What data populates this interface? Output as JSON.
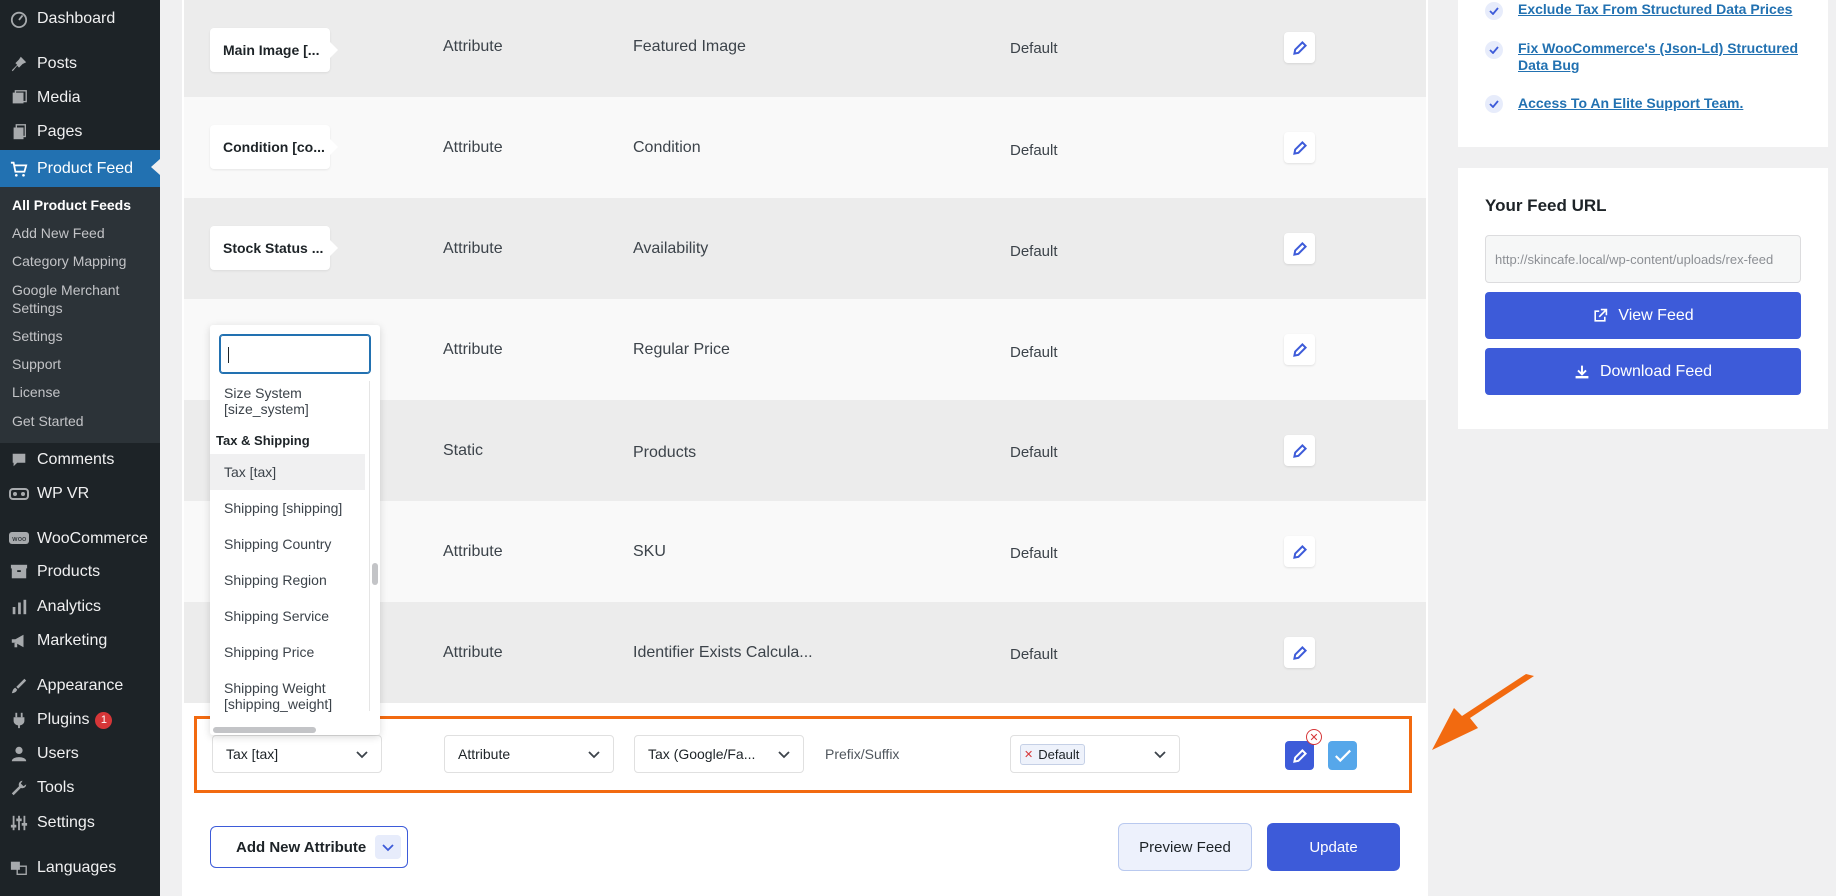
{
  "sidebar": {
    "items": [
      {
        "label": "Dashboard",
        "icon": "dashboard-icon"
      },
      {
        "label": "Posts",
        "icon": "pin-icon"
      },
      {
        "label": "Media",
        "icon": "media-icon"
      },
      {
        "label": "Pages",
        "icon": "pages-icon"
      },
      {
        "label": "Product Feed",
        "icon": "cart-icon"
      },
      {
        "label": "Comments",
        "icon": "comment-icon"
      },
      {
        "label": "WP VR",
        "icon": "vr-icon"
      },
      {
        "label": "WooCommerce",
        "icon": "woo-icon"
      },
      {
        "label": "Products",
        "icon": "box-icon"
      },
      {
        "label": "Analytics",
        "icon": "bar-chart-icon"
      },
      {
        "label": "Marketing",
        "icon": "megaphone-icon"
      },
      {
        "label": "Appearance",
        "icon": "brush-icon"
      },
      {
        "label": "Plugins",
        "icon": "plugin-icon",
        "badge": "1"
      },
      {
        "label": "Users",
        "icon": "user-icon"
      },
      {
        "label": "Tools",
        "icon": "wrench-icon"
      },
      {
        "label": "Settings",
        "icon": "settings-icon"
      },
      {
        "label": "Languages",
        "icon": "languages-icon"
      }
    ],
    "submenu": [
      "All Product Feeds",
      "Add New Feed",
      "Category Mapping",
      "Google Merchant Settings",
      "Settings",
      "Support",
      "License",
      "Get Started"
    ]
  },
  "rows": [
    {
      "name": "Main Image [...",
      "type": "Attribute",
      "value": "Featured Image",
      "prefix": "Default"
    },
    {
      "name": "Condition [co...",
      "type": "Attribute",
      "value": "Condition",
      "prefix": "Default"
    },
    {
      "name": "Stock Status ...",
      "type": "Attribute",
      "value": "Availability",
      "prefix": "Default"
    },
    {
      "name": "",
      "type": "Attribute",
      "value": "Regular Price",
      "prefix": "Default"
    },
    {
      "name": "",
      "type": "Static",
      "value": "Products",
      "prefix": "Default"
    },
    {
      "name": "",
      "type": "Attribute",
      "value": "SKU",
      "prefix": "Default"
    },
    {
      "name": "",
      "type": "Attribute",
      "value": "Identifier Exists Calcula...",
      "prefix": "Default"
    }
  ],
  "dropdown": {
    "search_value": "",
    "items_top": [
      "Size System",
      "[size_system]"
    ],
    "group_label": "Tax & Shipping",
    "items": [
      "Tax [tax]",
      "Shipping [shipping]",
      "Shipping Country",
      "Shipping Region",
      "Shipping Service",
      "Shipping Price"
    ],
    "items_bottom": [
      "Shipping Weight",
      "[shipping_weight]"
    ]
  },
  "edit_row": {
    "attribute": "Tax [tax]",
    "type": "Attribute",
    "value": "Tax (Google/Fa...",
    "prefix_label": "Prefix/Suffix",
    "tag": "Default"
  },
  "buttons": {
    "add_attribute": "Add New Attribute",
    "preview": "Preview Feed",
    "update": "Update"
  },
  "right_panel": {
    "features": [
      [
        "Exclude Tax From Structured Data Prices"
      ],
      [
        "Fix WooCommerce's (Json-Ld) Structured",
        "Data Bug"
      ],
      [
        "Access To An Elite Support Team."
      ]
    ],
    "feed_title": "Your Feed URL",
    "feed_url": "http://skincafe.local/wp-content/uploads/rex-feed",
    "view_feed": "View Feed",
    "download_feed": "Download Feed"
  },
  "colors": {
    "accent": "#3d5bd9",
    "highlight_border": "#f26a10",
    "wp_admin_bar": "#1d2327",
    "wp_active": "#2271b1"
  }
}
